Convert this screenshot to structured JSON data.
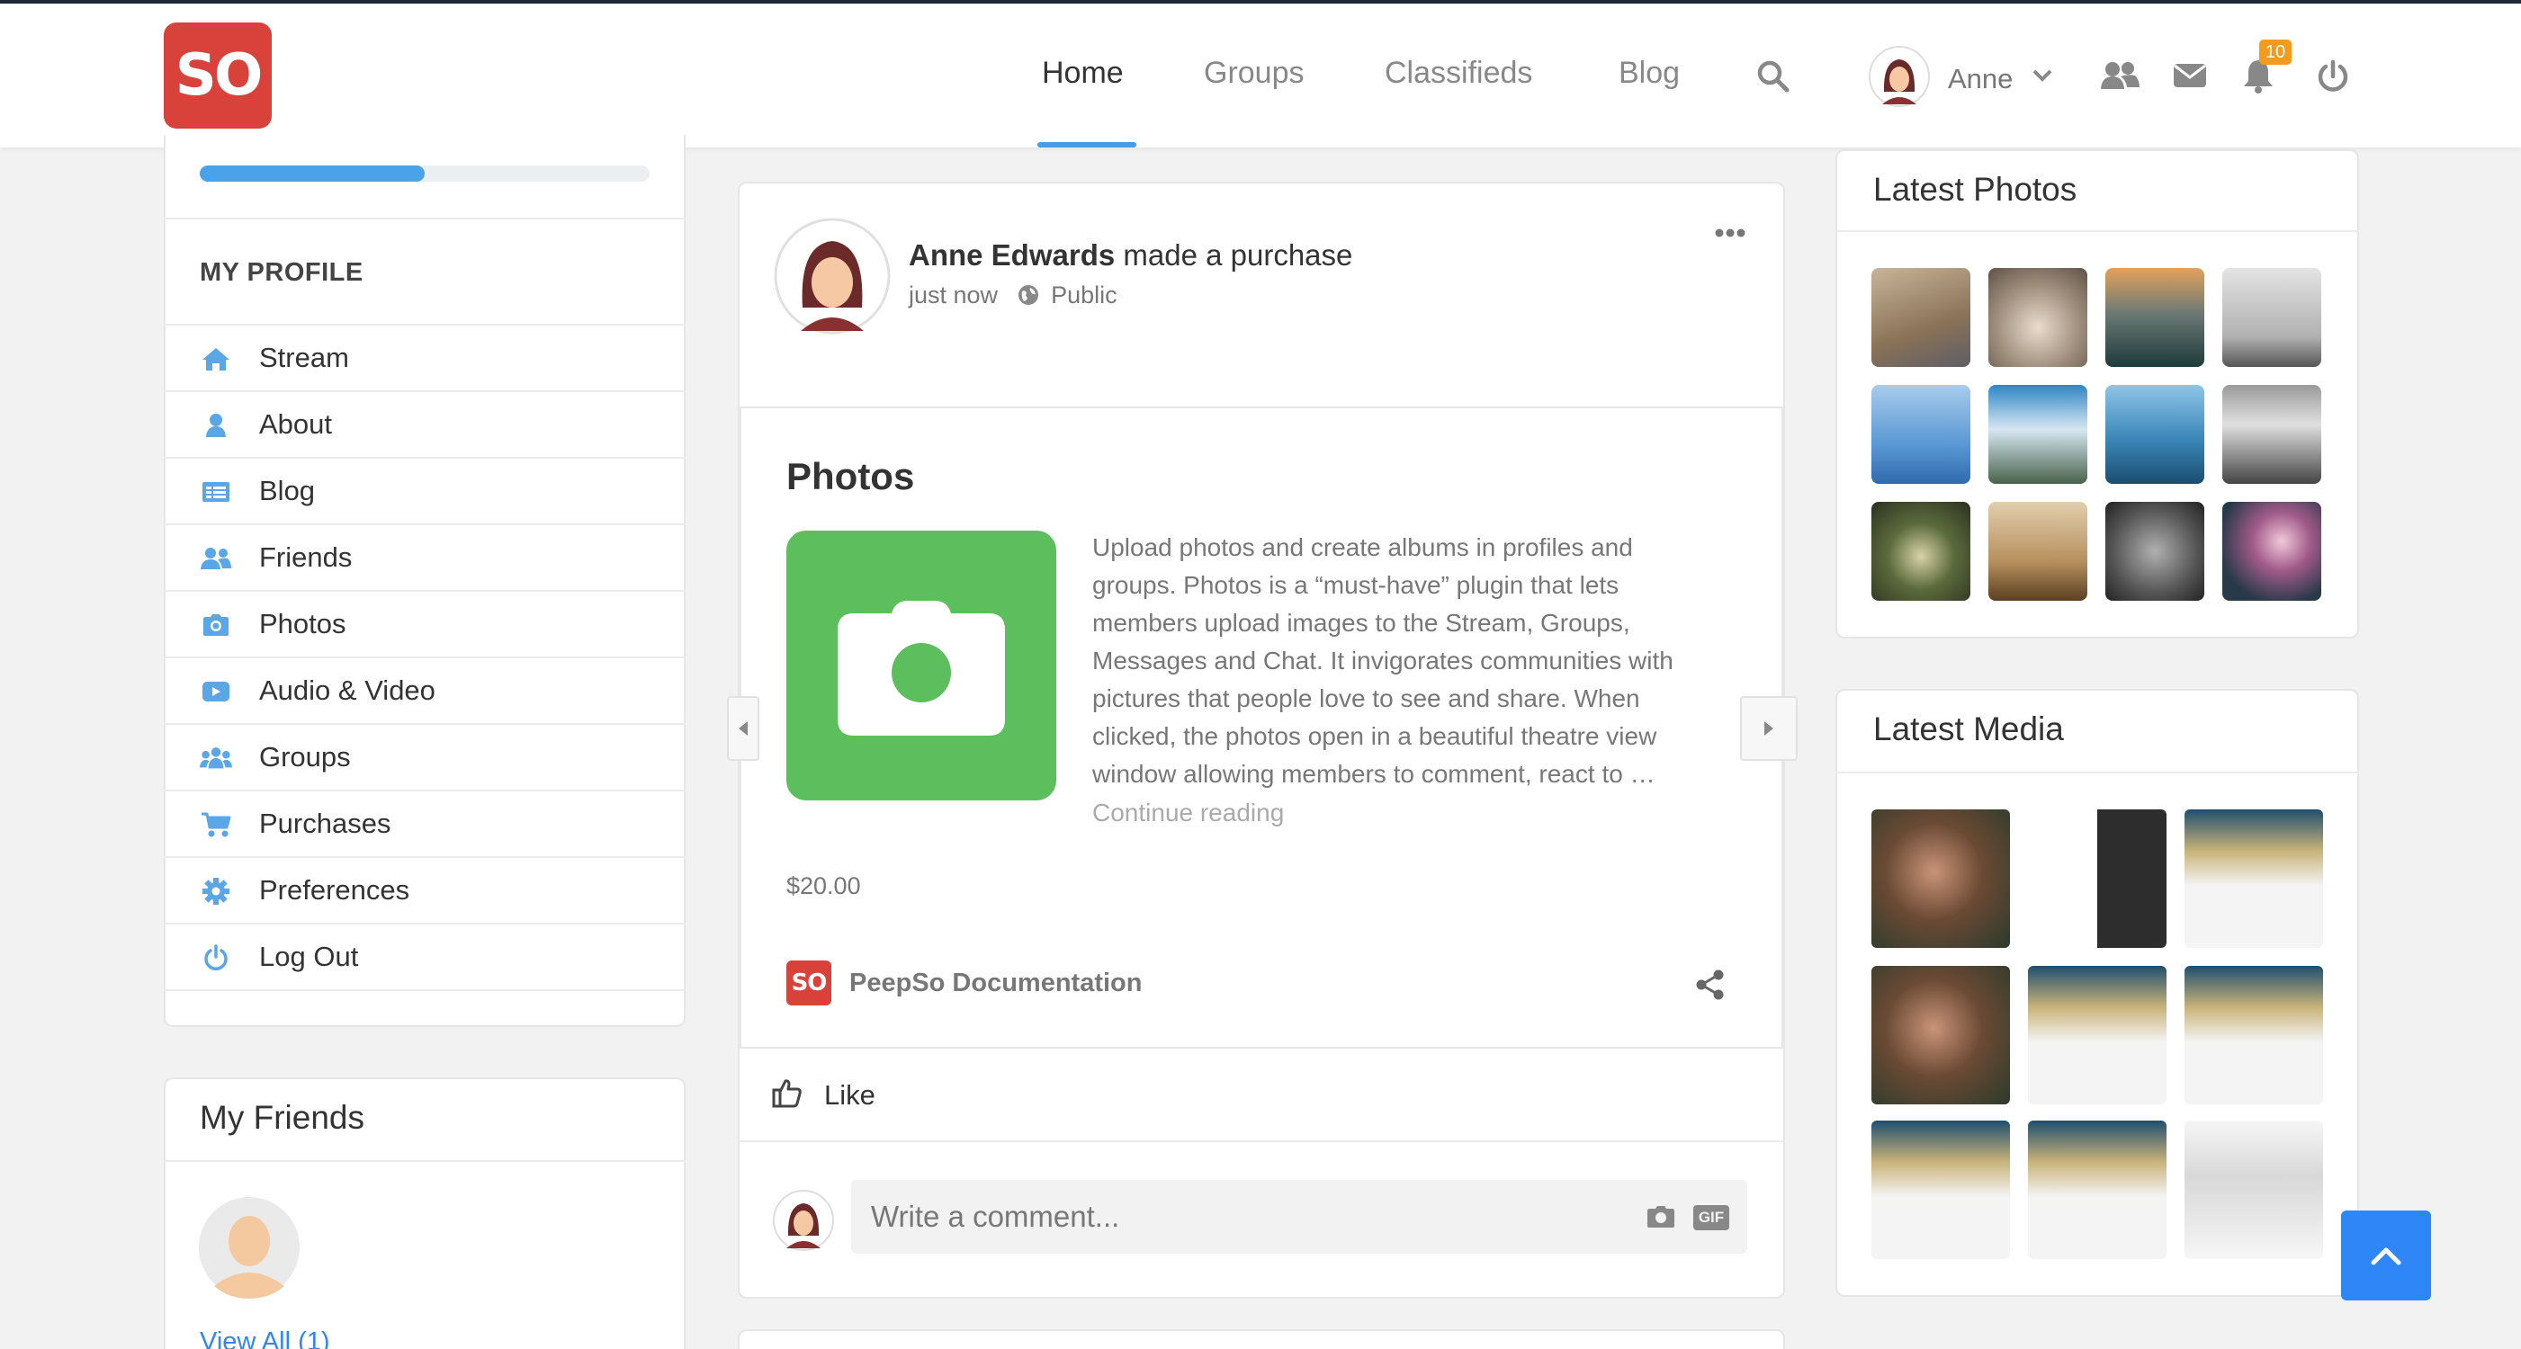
{
  "brand": {
    "logo_text": "SO",
    "accent": "#d9423b"
  },
  "nav": {
    "links": [
      "Home",
      "Groups",
      "Classifieds",
      "Blog"
    ],
    "user_name": "Anne",
    "notification_count": "10"
  },
  "sidebar": {
    "profile_progress": 0.5,
    "heading": "MY PROFILE",
    "items": [
      {
        "label": "Stream",
        "icon": "home-icon"
      },
      {
        "label": "About",
        "icon": "user-icon"
      },
      {
        "label": "Blog",
        "icon": "list-icon"
      },
      {
        "label": "Friends",
        "icon": "friends-icon"
      },
      {
        "label": "Photos",
        "icon": "camera-icon"
      },
      {
        "label": "Audio & Video",
        "icon": "video-icon"
      },
      {
        "label": "Groups",
        "icon": "groups-icon"
      },
      {
        "label": "Purchases",
        "icon": "cart-icon"
      },
      {
        "label": "Preferences",
        "icon": "gear-icon"
      },
      {
        "label": "Log Out",
        "icon": "power-icon"
      }
    ],
    "friends": {
      "title": "My Friends",
      "view_all": "View All (1)"
    }
  },
  "post": {
    "author": "Anne Edwards",
    "action": "made a purchase",
    "time": "just now",
    "privacy": "Public",
    "product": {
      "title": "Photos",
      "description": "Upload photos and create albums in profiles and groups. Photos is a “must-have” plugin that lets members upload images to the Stream, Groups, Messages and Chat. It invigorates communities with pictures that people love to see and share. When clicked, the photos open in a beautiful theatre view window allowing members to comment, react to …",
      "more": "Continue reading",
      "price": "$20.00",
      "store_logo": "SO",
      "store_name": "PeepSo Documentation"
    },
    "like_label": "Like",
    "comment_placeholder": "Write a comment..."
  },
  "widgets": {
    "photos_title": "Latest Photos",
    "media_title": "Latest Media"
  },
  "colors": {
    "accent_blue": "#4a9be0",
    "scroll_top": "#2f86f6",
    "product_green": "#5cbe5c"
  }
}
